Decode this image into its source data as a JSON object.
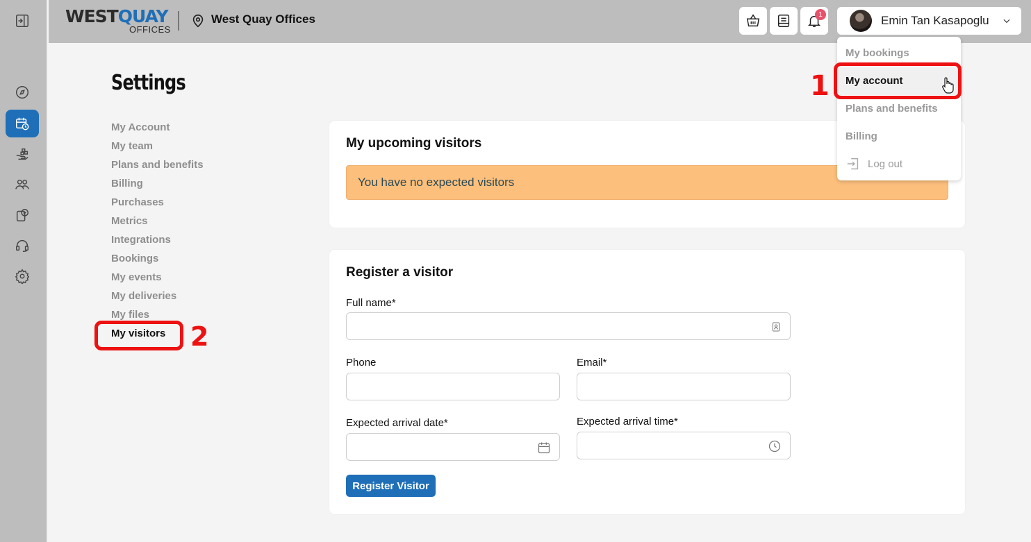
{
  "brand": {
    "logo_main": "WEST",
    "logo_accent": "QUAY",
    "logo_sub": "OFFICES",
    "location_name": "West Quay Offices",
    "accent_color": "#1e6fb8"
  },
  "topbar": {
    "notification_count": "1",
    "user_name": "Emin Tan Kasapoglu",
    "icons": [
      "basket-icon",
      "list-icon",
      "bell-icon",
      "chevron-down-icon"
    ]
  },
  "rail": {
    "icons": [
      "sidebar-expand-icon",
      "compass-icon",
      "calendar-clock-icon",
      "hand-boxes-icon",
      "people-icon",
      "clipboard-check-icon",
      "headset-icon",
      "gear-icon"
    ],
    "active": "calendar-clock-icon"
  },
  "settings": {
    "title": "Settings",
    "nav": [
      "My Account",
      "My team",
      "Plans and benefits",
      "Billing",
      "Purchases",
      "Metrics",
      "Integrations",
      "Bookings",
      "My events",
      "My deliveries",
      "My files",
      "My visitors"
    ],
    "active_item": "My visitors"
  },
  "upcoming": {
    "title": "My upcoming visitors",
    "empty_message": "You have no expected visitors",
    "alert_color": "#fcbf7c"
  },
  "register": {
    "title": "Register a visitor",
    "full_name_label": "Full name*",
    "phone_label": "Phone",
    "email_label": "Email*",
    "date_label": "Expected arrival date*",
    "time_label": "Expected arrival time*",
    "submit_label": "Register Visitor",
    "full_name_value": "",
    "phone_value": "",
    "email_value": "",
    "date_value": "",
    "time_value": ""
  },
  "user_menu": {
    "items": [
      "My bookings",
      "My account",
      "Plans and benefits",
      "Billing",
      "Log out"
    ],
    "hovered": "My account"
  },
  "annotations": {
    "step1": "1",
    "step2": "2",
    "highlight_color": "#ee1111"
  }
}
